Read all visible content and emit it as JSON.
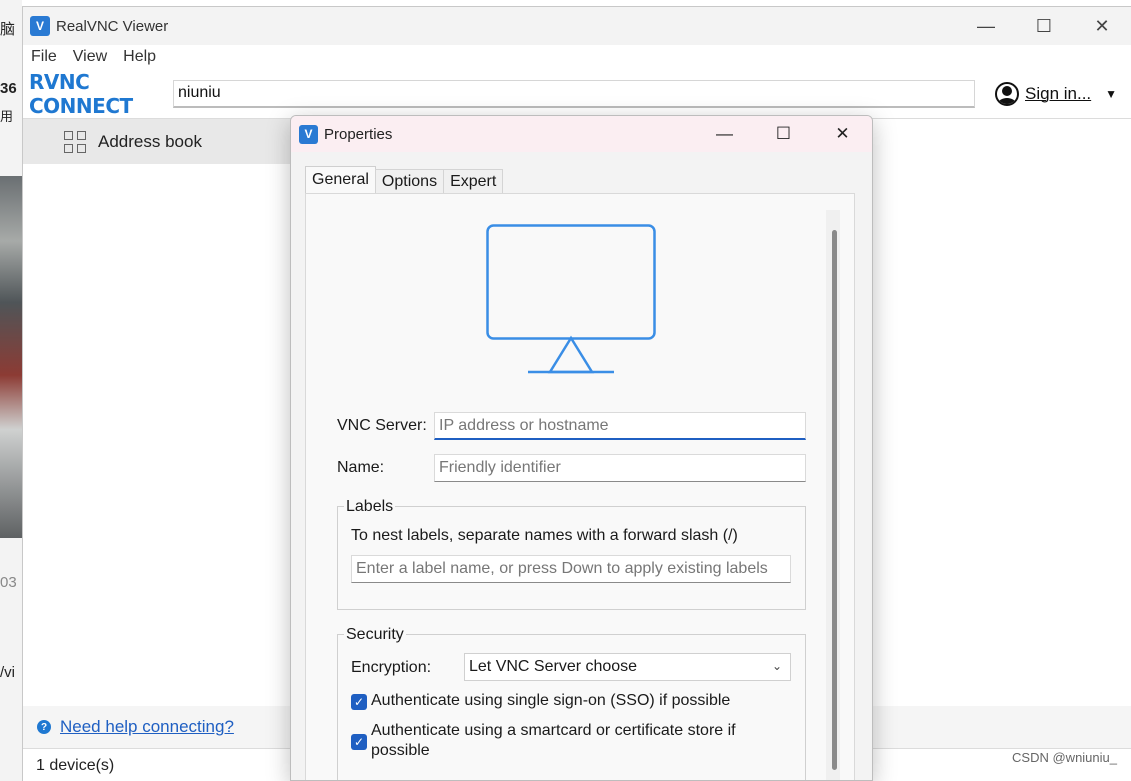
{
  "background_app": {
    "fragments": [
      "脑",
      "36",
      "用",
      "03",
      "/vi"
    ]
  },
  "main_window": {
    "title": "RealVNC Viewer",
    "controls": {
      "minimize": "—",
      "maximize": "☐",
      "close": "✕"
    },
    "menu": {
      "file": "File",
      "view": "View",
      "help": "Help"
    },
    "toolbar": {
      "logo": "RVNC CONNECT",
      "search_value": "niuniu",
      "signin_label": "Sign in...",
      "signin_caret": "▼"
    },
    "sidebar": {
      "address_book": "Address book"
    },
    "help_link": "Need help connecting?",
    "help_icon": "?",
    "status": "1 device(s)"
  },
  "watermark": "CSDN @wniuniu_",
  "dialog": {
    "title": "Properties",
    "controls": {
      "minimize": "—",
      "maximize": "☐",
      "close": "✕"
    },
    "tabs": [
      "General",
      "Options",
      "Expert"
    ],
    "vnc_server": {
      "label": "VNC Server:",
      "placeholder": "IP address or hostname"
    },
    "name": {
      "label": "Name:",
      "placeholder": "Friendly identifier"
    },
    "labels": {
      "group_title": "Labels",
      "hint": "To nest labels, separate names with a forward slash (/)",
      "placeholder": "Enter a label name, or press Down to apply existing labels"
    },
    "security": {
      "group_title": "Security",
      "encryption_label": "Encryption:",
      "encryption_value": "Let VNC Server choose",
      "sso_label": "Authenticate using single sign-on (SSO) if possible",
      "smartcard_label": "Authenticate using a smartcard or certificate store if possible",
      "check_mark": "✓"
    }
  },
  "colors": {
    "accent": "#1f78d1",
    "link": "#1f5fc2",
    "dialog_titlebar": "#fbeef2"
  }
}
